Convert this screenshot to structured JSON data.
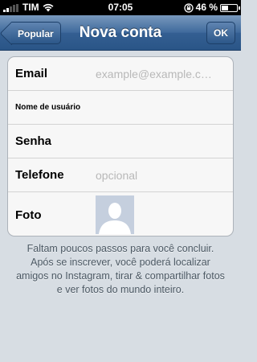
{
  "status_bar": {
    "carrier": "TIM",
    "time": "07:05",
    "battery_percent": "46 %",
    "battery_level": 0.46,
    "signal_bars": 2,
    "icons": [
      "signal-icon",
      "wifi-icon",
      "lock-rotation-icon",
      "battery-icon"
    ]
  },
  "nav": {
    "title": "Nova conta",
    "back_label": "Popular",
    "ok_label": "OK"
  },
  "form": {
    "fields": [
      {
        "label": "Email",
        "placeholder": "example@example.c…"
      },
      {
        "label": "Nome de usuário",
        "placeholder": ""
      },
      {
        "label": "Senha",
        "placeholder": ""
      },
      {
        "label": "Telefone",
        "placeholder": "opcional"
      },
      {
        "label": "Foto",
        "placeholder": ""
      }
    ]
  },
  "info_text": "Faltam poucos passos para você concluir. Após se inscrever, você poderá localizar amigos no Instagram, tirar & compartilhar fotos e ver fotos do mundo inteiro.",
  "colors": {
    "nav_blue": "#2a5587",
    "background": "#d7dde3",
    "placeholder_gray": "#b8b8b8"
  }
}
